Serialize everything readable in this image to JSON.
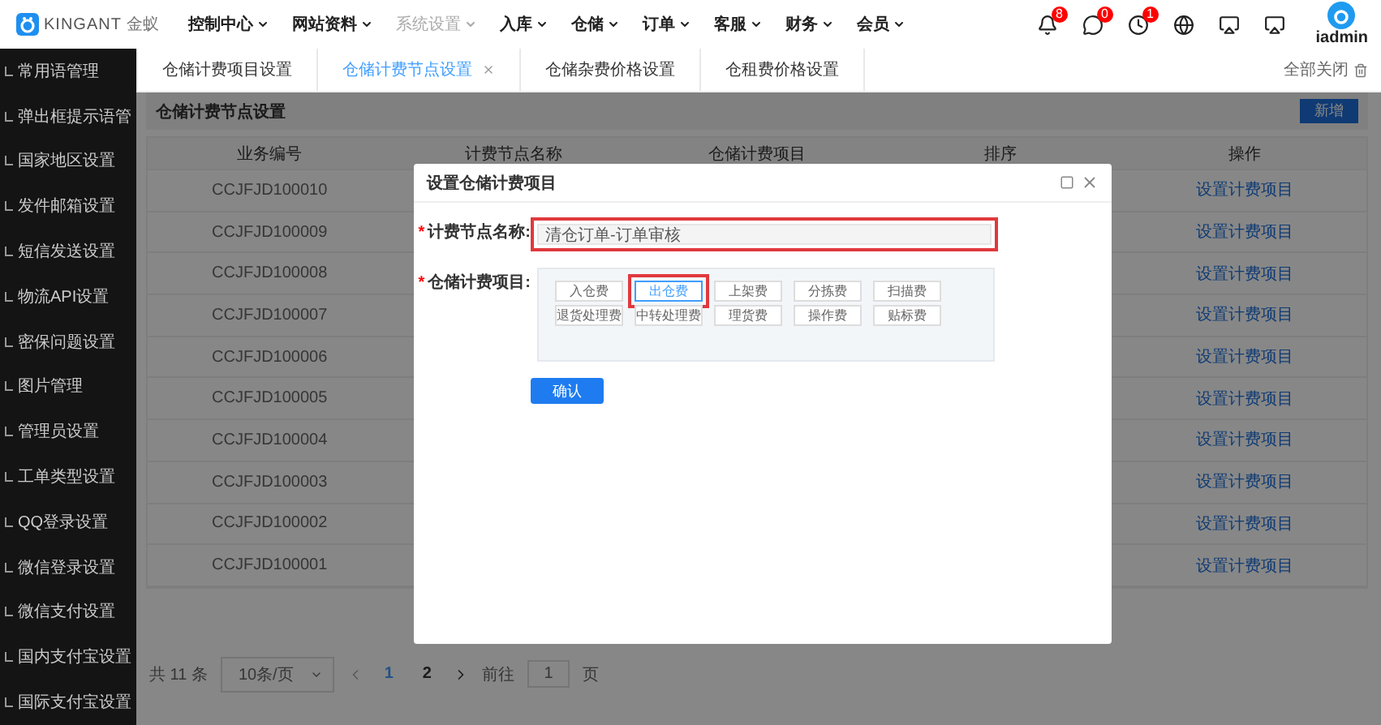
{
  "brand": {
    "name": "KINGANT",
    "suffix": "金蚁"
  },
  "nav": [
    {
      "label": "控制中心",
      "selected": false
    },
    {
      "label": "网站资料",
      "selected": false
    },
    {
      "label": "系统设置",
      "selected": true
    },
    {
      "label": "入库",
      "selected": false
    },
    {
      "label": "仓储",
      "selected": false
    },
    {
      "label": "订单",
      "selected": false
    },
    {
      "label": "客服",
      "selected": false
    },
    {
      "label": "财务",
      "selected": false
    },
    {
      "label": "会员",
      "selected": false
    }
  ],
  "header_icons": [
    {
      "kind": "bell",
      "badge": "8"
    },
    {
      "kind": "chat",
      "badge": "0"
    },
    {
      "kind": "clock",
      "badge": "1"
    },
    {
      "kind": "globe"
    },
    {
      "kind": "screen"
    },
    {
      "kind": "screen"
    }
  ],
  "user": {
    "name": "iadmin"
  },
  "sidebar": {
    "items": [
      "常用语管理",
      "弹出框提示语管",
      "国家地区设置",
      "发件邮箱设置",
      "短信发送设置",
      "物流API设置",
      "密保问题设置",
      "图片管理",
      "管理员设置",
      "工单类型设置",
      "QQ登录设置",
      "微信登录设置",
      "微信支付设置",
      "国内支付宝设置",
      "国际支付宝设置"
    ]
  },
  "tabs": [
    {
      "label": "仓储计费项目设置",
      "selected": false,
      "closable": false
    },
    {
      "label": "仓储计费节点设置",
      "selected": true,
      "closable": true
    },
    {
      "label": "仓储杂费价格设置",
      "selected": false,
      "closable": false
    },
    {
      "label": "仓租费价格设置",
      "selected": false,
      "closable": false
    }
  ],
  "close_all": "全部关闭",
  "panel": {
    "title": "仓储计费节点设置",
    "add_button": "新增"
  },
  "table": {
    "columns": [
      "业务编号",
      "计费节点名称",
      "仓储计费项目",
      "排序",
      "操作"
    ],
    "rows": [
      {
        "code": "CCJFJD100010",
        "action": "设置计费项目"
      },
      {
        "code": "CCJFJD100009",
        "action": "设置计费项目"
      },
      {
        "code": "CCJFJD100008",
        "action": "设置计费项目"
      },
      {
        "code": "CCJFJD100007",
        "action": "设置计费项目"
      },
      {
        "code": "CCJFJD100006",
        "action": "设置计费项目"
      },
      {
        "code": "CCJFJD100005",
        "action": "设置计费项目"
      },
      {
        "code": "CCJFJD100004",
        "action": "设置计费项目"
      },
      {
        "code": "CCJFJD100003",
        "action": "设置计费项目"
      },
      {
        "code": "CCJFJD100002",
        "action": "设置计费项目"
      },
      {
        "code": "CCJFJD100001",
        "action": "设置计费项目"
      }
    ]
  },
  "pagination": {
    "total": "共 11 条",
    "page_size": "10条/页",
    "pages": [
      {
        "label": "1",
        "selected": true
      },
      {
        "label": "2",
        "selected": false
      }
    ],
    "goto_label": "前往",
    "goto_value": "1",
    "goto_suffix": "页"
  },
  "dialog": {
    "title": "设置仓储计费项目",
    "name_field": {
      "required_mark": "*",
      "label": "计费节点名称:",
      "value": "清仓订单-订单审核",
      "highlighted": true
    },
    "fees_required_mark": "*",
    "fees_label": "仓储计费项目:",
    "fees": [
      {
        "label": "入仓费",
        "selected": false,
        "highlighted": false
      },
      {
        "label": "出仓费",
        "selected": true,
        "highlighted": true
      },
      {
        "label": "上架费",
        "selected": false,
        "highlighted": false
      },
      {
        "label": "分拣费",
        "selected": false,
        "highlighted": false
      },
      {
        "label": "扫描费",
        "selected": false,
        "highlighted": false
      },
      {
        "label": "退货处理费",
        "selected": false,
        "highlighted": false
      },
      {
        "label": "中转处理费",
        "selected": false,
        "highlighted": false
      },
      {
        "label": "理货费",
        "selected": false,
        "highlighted": false
      },
      {
        "label": "操作费",
        "selected": false,
        "highlighted": false
      },
      {
        "label": "贴标费",
        "selected": false,
        "highlighted": false
      }
    ],
    "confirm": "确认"
  }
}
